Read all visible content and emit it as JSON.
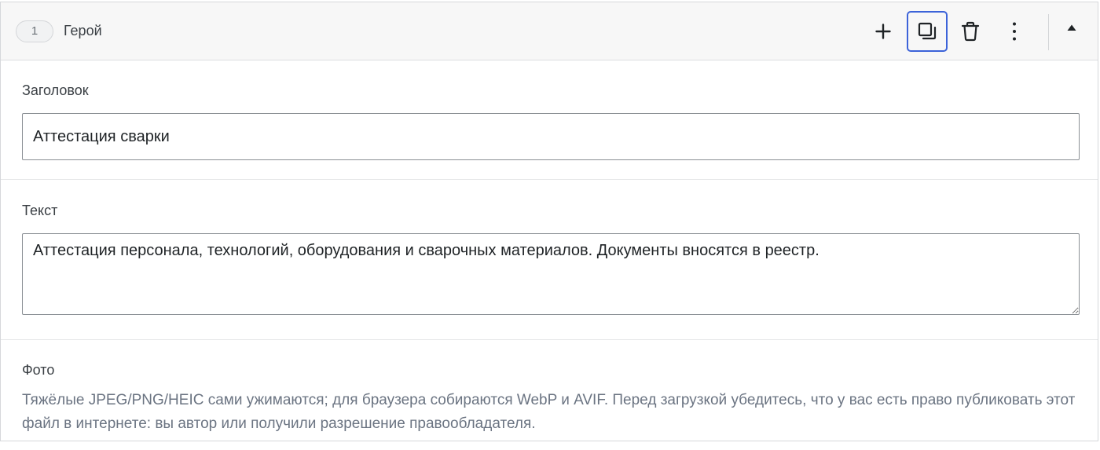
{
  "block": {
    "number": "1",
    "title": "Герой"
  },
  "toolbar": {
    "add_icon": "plus-icon",
    "duplicate_icon": "copy-icon",
    "delete_icon": "trash-icon",
    "more_icon": "more-vertical-icon",
    "collapse_icon": "triangle-up-icon",
    "accent_color": "#3c63d9"
  },
  "fields": {
    "heading": {
      "label": "Заголовок",
      "value": "Аттестация сварки"
    },
    "text": {
      "label": "Текст",
      "value": "Аттестация персонала, технологий, оборудования и сварочных материалов. Документы вносятся в реестр."
    },
    "photo": {
      "label": "Фото",
      "help": "Тяжёлые JPEG/PNG/HEIC сами ужимаются; для браузера собираются WebP и AVIF. Перед загрузкой убедитесь, что у вас есть право публиковать этот файл в интернете: вы автор или получили разрешение правообладателя."
    }
  }
}
